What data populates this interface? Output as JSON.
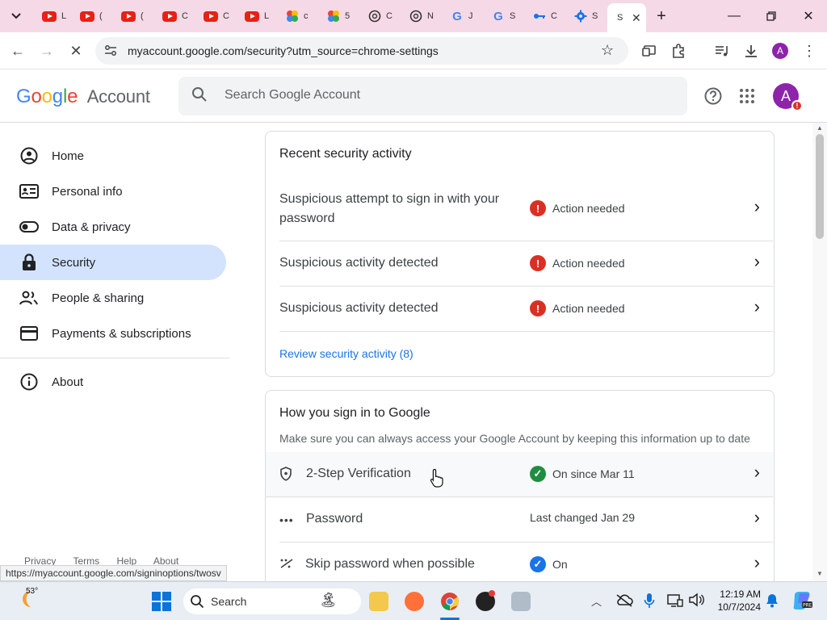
{
  "browser": {
    "tabs": [
      {
        "icon": "youtube-icon",
        "text": "L"
      },
      {
        "icon": "youtube-icon",
        "text": "("
      },
      {
        "icon": "youtube-icon",
        "text": "("
      },
      {
        "icon": "youtube-icon",
        "text": "C"
      },
      {
        "icon": "youtube-icon",
        "text": "C"
      },
      {
        "icon": "youtube-icon",
        "text": "L"
      },
      {
        "icon": "google-photos-icon",
        "text": "c"
      },
      {
        "icon": "google-photos-icon",
        "text": "5"
      },
      {
        "icon": "chatgpt-icon",
        "text": "C"
      },
      {
        "icon": "chatgpt-icon",
        "text": "N"
      },
      {
        "icon": "google-icon",
        "text": "J"
      },
      {
        "icon": "google-icon",
        "text": "S"
      },
      {
        "icon": "password-key-icon",
        "text": "C"
      },
      {
        "icon": "settings-gear-icon",
        "text": "S"
      },
      {
        "icon": "google-icon",
        "text": "S"
      }
    ],
    "new_tab_label": "+",
    "url": "myaccount.google.com/security?utm_source=chrome-settings",
    "profile_letter": "A",
    "status_url": "https://myaccount.google.com/signinoptions/twosv"
  },
  "header": {
    "logo_google": "Google",
    "logo_account": "Account",
    "search_placeholder": "Search Google Account",
    "avatar_letter": "A",
    "avatar_alert": "!"
  },
  "sidebar": {
    "items": [
      {
        "label": "Home"
      },
      {
        "label": "Personal info"
      },
      {
        "label": "Data & privacy"
      },
      {
        "label": "Security"
      },
      {
        "label": "People & sharing"
      },
      {
        "label": "Payments & subscriptions"
      },
      {
        "label": "About"
      }
    ],
    "footer": [
      "Privacy",
      "Terms",
      "Help",
      "About"
    ]
  },
  "recent_activity": {
    "title": "Recent security activity",
    "rows": [
      {
        "line1": "Suspicious attempt to sign in with your",
        "line2": "password",
        "status": "Action needed"
      },
      {
        "line1": "Suspicious activity detected",
        "status": "Action needed"
      },
      {
        "line1": "Suspicious activity detected",
        "status": "Action needed"
      }
    ],
    "review_link": "Review security activity (8)"
  },
  "signin": {
    "title": "How you sign in to Google",
    "subtitle": "Make sure you can always access your Google Account by keeping this information up to date",
    "rows": [
      {
        "label": "2-Step Verification",
        "status": "On since Mar 11"
      },
      {
        "label": "Password",
        "status": "Last changed Jan 29"
      },
      {
        "label": "Skip password when possible",
        "status": "On"
      }
    ]
  },
  "taskbar": {
    "weather_temp": "53°",
    "search_placeholder": "Search",
    "time": "12:19 AM",
    "date": "10/7/2024"
  },
  "colors": {
    "tab_strip": "#f6d9e6",
    "active_nav": "#d3e3fd",
    "alert_red": "#d93025",
    "ok_green": "#1e8e3e",
    "link_blue": "#1a73e8"
  }
}
